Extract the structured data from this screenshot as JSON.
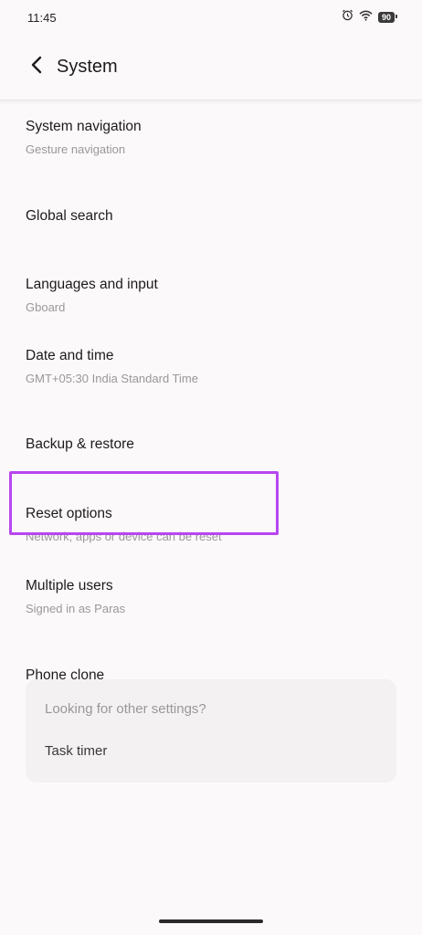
{
  "status_bar": {
    "time": "11:45",
    "battery": "90"
  },
  "header": {
    "title": "System"
  },
  "settings": [
    {
      "title": "System navigation",
      "subtitle": "Gesture navigation"
    },
    {
      "title": "Global search",
      "subtitle": ""
    },
    {
      "title": "Languages and input",
      "subtitle": "Gboard"
    },
    {
      "title": "Date and time",
      "subtitle": "GMT+05:30 India Standard Time"
    },
    {
      "title": "Backup & restore",
      "subtitle": ""
    },
    {
      "title": "Reset options",
      "subtitle": "Network, apps or device can be reset"
    },
    {
      "title": "Multiple users",
      "subtitle": "Signed in as Paras"
    },
    {
      "title": "Phone clone",
      "subtitle": ""
    }
  ],
  "suggestions": {
    "heading": "Looking for other settings?",
    "link": "Task timer"
  },
  "colors": {
    "background": "#fcf9fa",
    "highlight": "#b846f0",
    "card": "#f3f1f2"
  }
}
